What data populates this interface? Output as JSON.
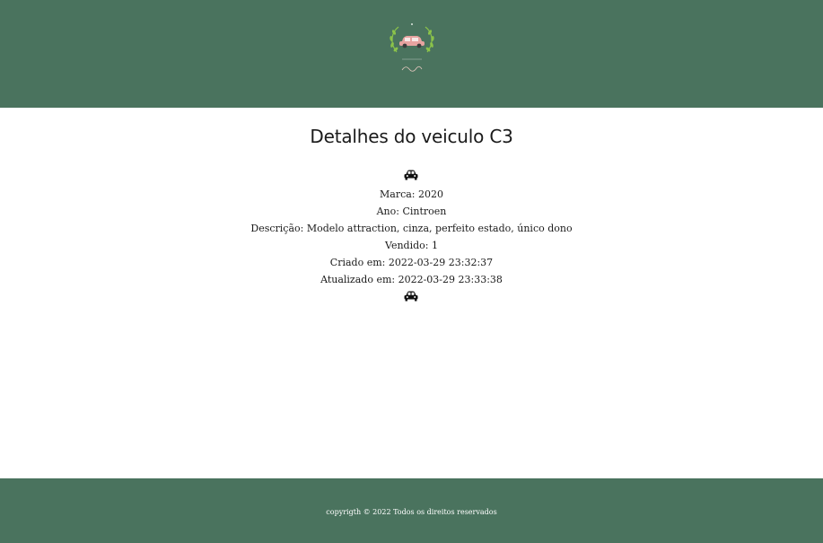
{
  "header": {
    "logo_icon": "car-wreath-logo",
    "brand_colors": {
      "header_bg": "#4a735e",
      "footer_bg": "#4a735e",
      "logo_car": "#e7a3a0",
      "logo_wreath": "#8bc34a"
    }
  },
  "main": {
    "title": "Detalhes do veiculo C3",
    "icon_top": "car-icon",
    "icon_bottom": "car-icon",
    "details": [
      "Marca: 2020",
      "Ano: Cintroen",
      "Descrição: Modelo attraction, cinza, perfeito estado, único dono",
      "Vendido: 1",
      "Criado em: 2022-03-29 23:32:37",
      "Atualizado em: 2022-03-29 23:33:38"
    ]
  },
  "footer": {
    "copyright": "copyrigth © 2022 Todos os direitos reservados"
  }
}
